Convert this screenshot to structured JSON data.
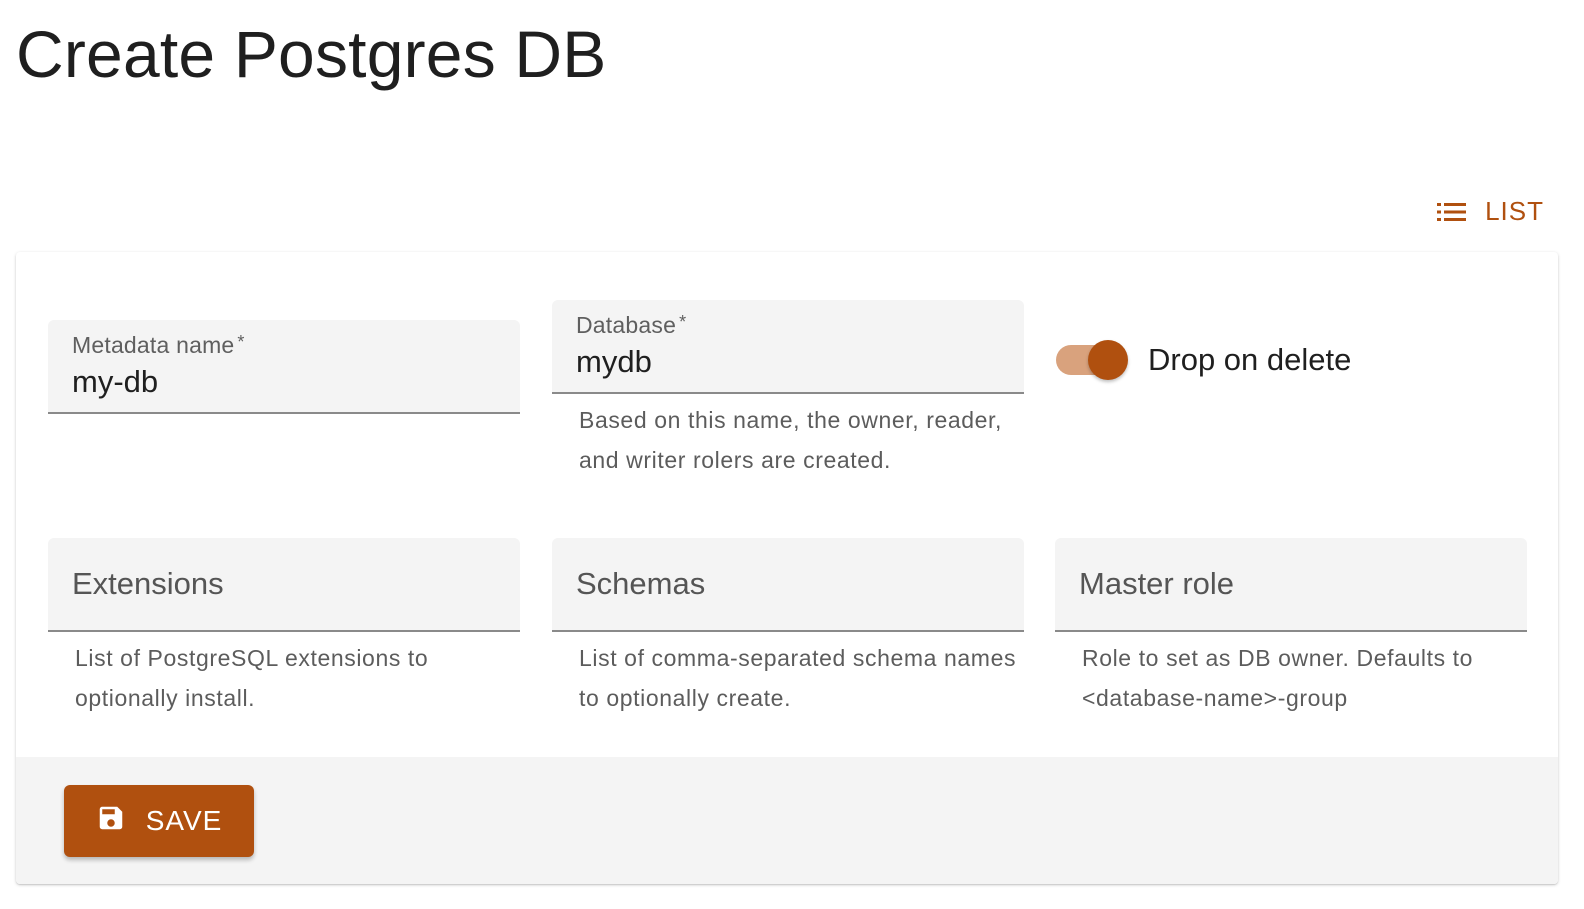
{
  "page": {
    "title": "Create Postgres DB"
  },
  "header": {
    "list_label": "LIST"
  },
  "form": {
    "metadata_name": {
      "label": "Metadata name",
      "required_mark": "*",
      "value": "my-db"
    },
    "database": {
      "label": "Database",
      "required_mark": "*",
      "value": "mydb",
      "helper": "Based on this name, the owner, reader, and writer rolers are created."
    },
    "drop_on_delete": {
      "label": "Drop on delete",
      "checked": true
    },
    "extensions": {
      "label": "Extensions",
      "value": "",
      "helper": "List of PostgreSQL extensions to optionally install."
    },
    "schemas": {
      "label": "Schemas",
      "value": "",
      "helper": "List of comma-separated schema names to optionally create."
    },
    "master_role": {
      "label": "Master role",
      "value": "",
      "helper": "Role to set as DB owner. Defaults to <database-name>-group"
    }
  },
  "toolbar": {
    "save_label": "SAVE"
  },
  "colors": {
    "accent": "#b0500f",
    "accent_light": "#d9a27d",
    "field_bg": "#f4f4f4",
    "toolbar_bg": "#f4f4f4"
  },
  "icons": {
    "list": "list-icon",
    "save": "save-icon"
  }
}
